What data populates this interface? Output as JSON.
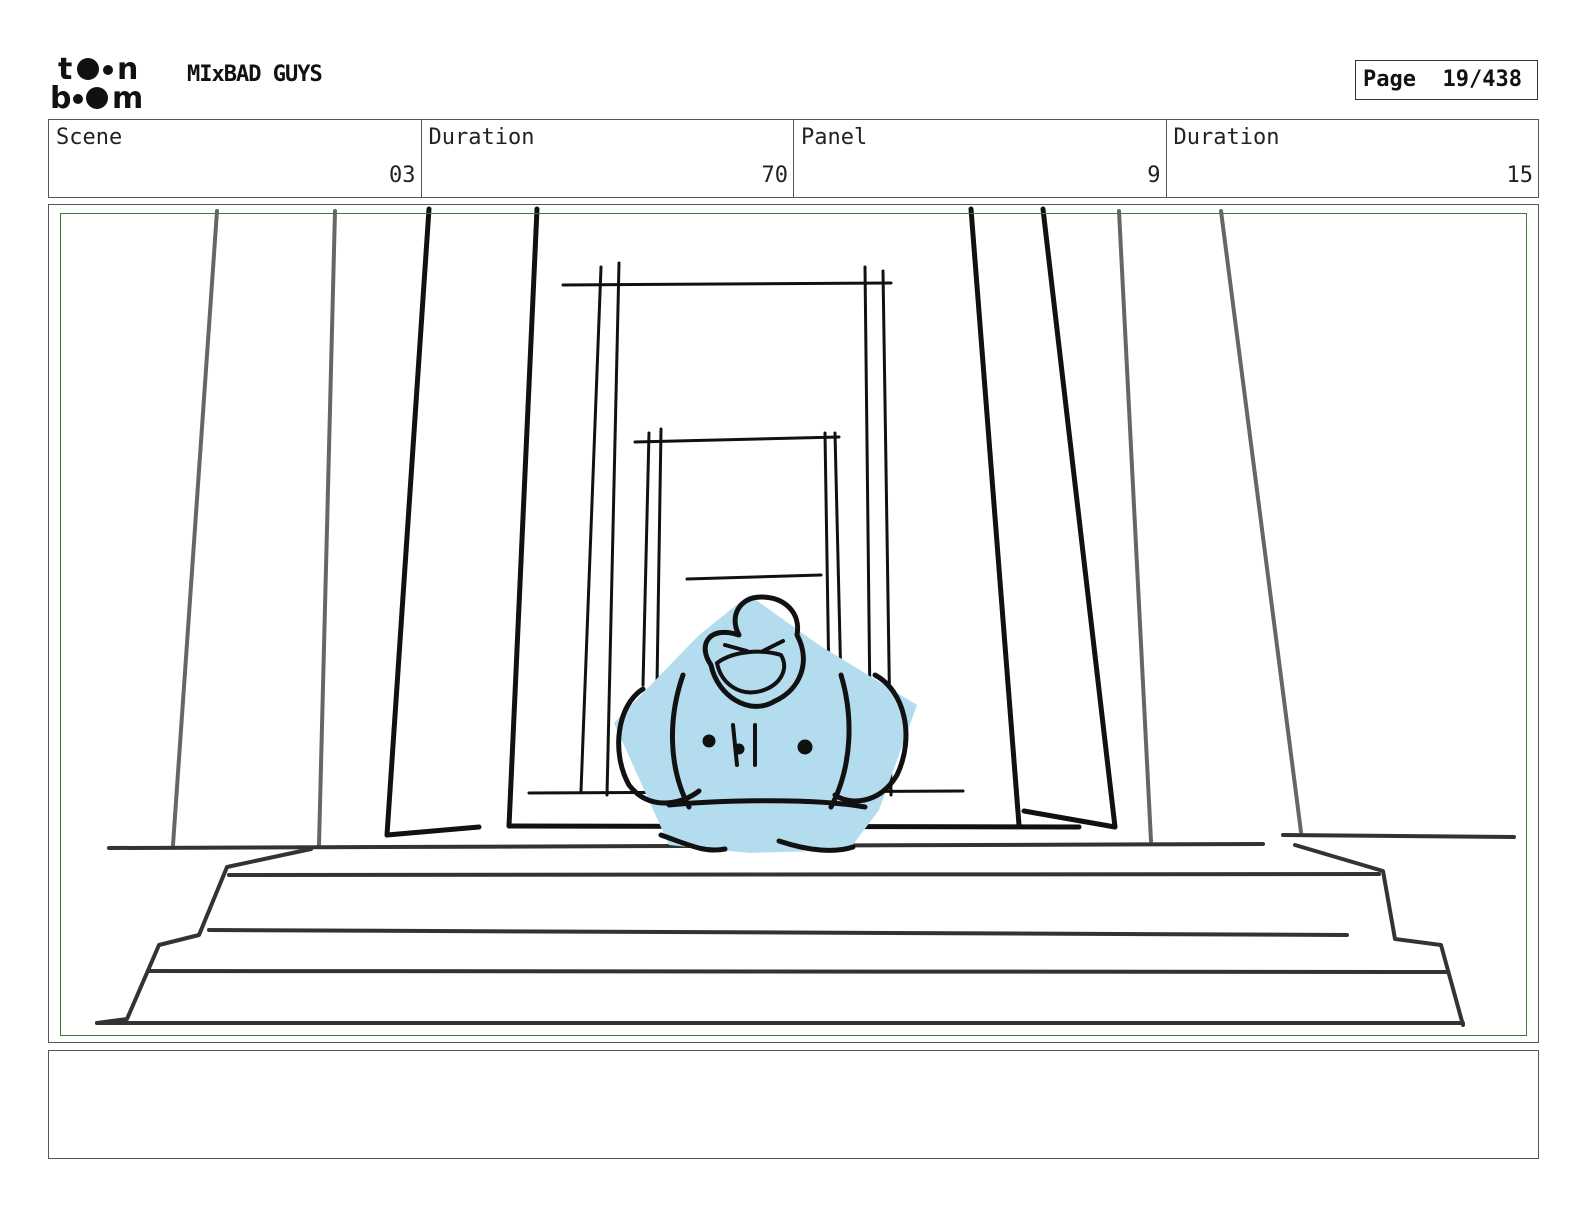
{
  "header": {
    "logo_top": "to●n",
    "logo_bottom": "b●●m",
    "project_title": "MIxBAD GUYS",
    "page_label": "Page",
    "page_number": "19/438"
  },
  "info": [
    {
      "label": "Scene",
      "value": "03"
    },
    {
      "label": "Duration",
      "value": "70"
    },
    {
      "label": "Panel",
      "value": "9"
    },
    {
      "label": "Duration",
      "value": "15"
    }
  ],
  "panel": {
    "character_fill": "#b4dcef",
    "safe_area_color": "#3b7a3b",
    "line_color": "#111111"
  },
  "caption": {
    "text": ""
  }
}
